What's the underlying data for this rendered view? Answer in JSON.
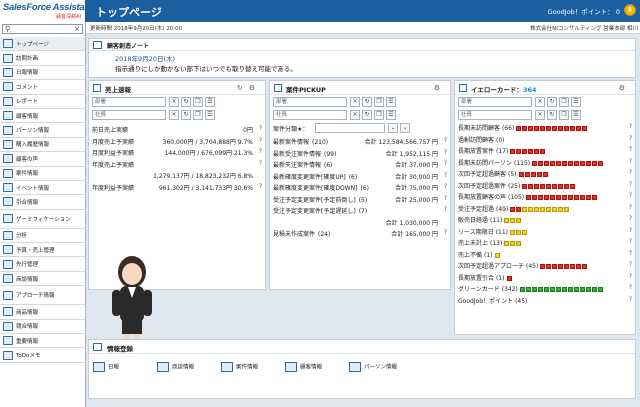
{
  "header": {
    "logo": "SalesForce Assistant",
    "logo_sub": "顧客深耕AI",
    "title": "トップページ",
    "points": "GoodJob！ポイント： 0",
    "coin": "$"
  },
  "subheader": {
    "updated": "更新時間 2018年9月20日(木) 20:00",
    "company": "株式会社NIコンサルティング 営業本部 相川 "
  },
  "sidebar": {
    "search_placeholder": "",
    "search_icon": "magnifier-icon",
    "clear_icon": "close-icon",
    "items": [
      "トップページ",
      "訪問計画",
      "日報情報",
      "コメント",
      "レポート",
      "顧客情報",
      "パーソン情報",
      "購入履歴情報",
      "顧客の声",
      "案件情報",
      "イベント情報",
      "引合情報",
      "ゲーミフィケーション",
      "分析",
      "予算・売上管理",
      "先行管理",
      "商談情報",
      "アプローチ情報",
      "商品情報",
      "競合情報",
      "重要情報",
      "ToDoメモ"
    ]
  },
  "note": {
    "title": "顧客創造ノート",
    "date": "2018年9月20日(木)",
    "body": "指示通りにしか動かない部下はいつでも取り替え可能である。"
  },
  "sales": {
    "title": "売上速報",
    "dept_placeholder": "部署",
    "emp_placeholder": "社員",
    "rows": [
      {
        "label": "前日売上実績",
        "value": "0円"
      },
      {
        "label": "月度売上予実績",
        "value": "360,000円 / 3,704,888円 9.7%"
      },
      {
        "label": "月度利益予実績",
        "value": "144,000円 / 676,099円 21.3%"
      },
      {
        "label": "年度売上予実績",
        "value": ""
      },
      {
        "label": "",
        "value": "1,279,137円 / 18,823,232円 6.8%"
      },
      {
        "label": "年度利益予実績",
        "value": "961,302円 / 3,141,733円 30.6%"
      }
    ]
  },
  "pickup": {
    "title": "案件PICKUP",
    "dept_placeholder": "部署",
    "emp_placeholder": "社員",
    "category_label": "案件分類★：",
    "rows": [
      {
        "label": "最新案件情報",
        "count": "(210)",
        "amount": "合計 123,584,566,757 円"
      },
      {
        "label": "最新受注案件情報",
        "count": "(99)",
        "amount": "合計 1,952,115 円"
      },
      {
        "label": "最新失注案件情報",
        "count": "(6)",
        "amount": "合計 37,000 円"
      },
      {
        "label": "最新確度変更案件[確度UP]",
        "count": "(6)",
        "amount": "合計 30,000 円"
      },
      {
        "label": "最新確度変更案件[確度DOWN]",
        "count": "(6)",
        "amount": "合計 75,000 円"
      },
      {
        "label": "受注予定変更案件[予定前倒し]",
        "count": "(5)",
        "amount": "合計 25,000 円"
      },
      {
        "label": "受注予定変更案件[予定遅延し]",
        "count": "(7)",
        "amount": ""
      },
      {
        "label": "",
        "count": "",
        "amount": "合計 1,030,000 円"
      },
      {
        "label": "見積未作成案件",
        "count": "(24)",
        "amount": "合計 165,000 円"
      }
    ]
  },
  "yellow": {
    "title": "イエローカード：",
    "count": "364",
    "dept_placeholder": "部署",
    "emp_placeholder": "社員",
    "rows": [
      {
        "label": "長期未訪問顧客",
        "count": "(66)",
        "red": 12,
        "yellow": 0,
        "green": 0
      },
      {
        "label": "過剰訪問顧客",
        "count": "(0)",
        "red": 0,
        "yellow": 0,
        "green": 0
      },
      {
        "label": "長期放置案件",
        "count": "(17)",
        "red": 6,
        "yellow": 0,
        "green": 0
      },
      {
        "label": "長期未訪問パーソン",
        "count": "(115)",
        "red": 12,
        "yellow": 0,
        "green": 0
      },
      {
        "label": "次回予定超過顧客",
        "count": "(5)",
        "red": 5,
        "yellow": 0,
        "green": 0
      },
      {
        "label": "次回予定超過案件",
        "count": "(25)",
        "red": 9,
        "yellow": 0,
        "green": 0
      },
      {
        "label": "長期放置顧客の声",
        "count": "(105)",
        "red": 12,
        "yellow": 0,
        "green": 0
      },
      {
        "label": "受注予定超過",
        "count": "(49)",
        "red": 2,
        "yellow": 8,
        "green": 0
      },
      {
        "label": "販売日経過",
        "count": "(11)",
        "red": 0,
        "yellow": 3,
        "green": 0
      },
      {
        "label": "リース期限日",
        "count": "(11)",
        "red": 0,
        "yellow": 3,
        "green": 0
      },
      {
        "label": "売上未計上",
        "count": "(13)",
        "red": 0,
        "yellow": 3,
        "green": 0
      },
      {
        "label": "売上不備",
        "count": "(1)",
        "red": 0,
        "yellow": 1,
        "green": 0
      },
      {
        "label": "次回予定超過アプローチ",
        "count": "(45)",
        "red": 8,
        "yellow": 0,
        "green": 0
      },
      {
        "label": "長期放置引合",
        "count": "(1)",
        "red": 1,
        "yellow": 0,
        "green": 0
      },
      {
        "label": "グリーンカード",
        "count": "(342)",
        "red": 0,
        "yellow": 0,
        "green": 14
      },
      {
        "label": "GoodJob！ポイント",
        "count": "(45)",
        "red": 0,
        "yellow": 0,
        "green": 0
      }
    ]
  },
  "info": {
    "title": "情報登録",
    "items": [
      "日報",
      "商談情報",
      "案件情報",
      "顧客情報",
      "パーソン情報"
    ]
  },
  "colors": {
    "header": "#1a5f9f",
    "red": "#e53222",
    "yellow": "#f3d21c",
    "green": "#3cb03c"
  }
}
